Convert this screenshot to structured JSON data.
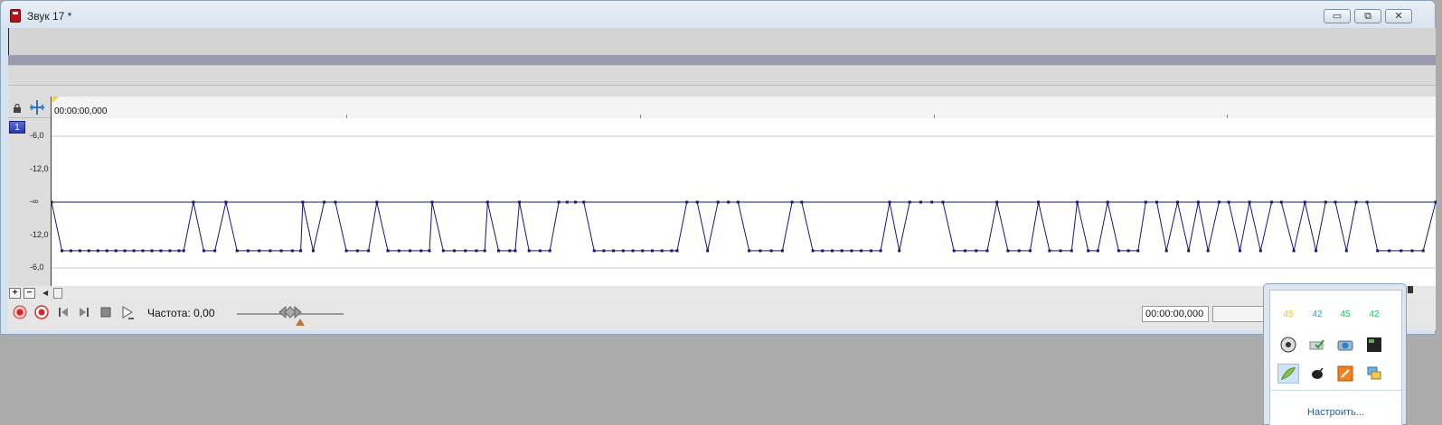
{
  "window": {
    "title": "Звук 17 *",
    "minimize_glyph": "▭",
    "maximize_glyph": "⧉",
    "close_glyph": "✕"
  },
  "timeline": {
    "time_start": "00:00:00,000"
  },
  "track": {
    "number": "1",
    "y_labels": [
      "-6,0",
      "-12,0",
      "-∞",
      "-12,0",
      "-6,0"
    ]
  },
  "controls": {
    "zoom_in": "+",
    "zoom_out": "−",
    "scroll_left": "◀",
    "frequency_label": "Частота: 0,00",
    "time_display": "00:00:00,000"
  },
  "tray": {
    "numbers": [
      {
        "value": "45",
        "color": "#e8c420"
      },
      {
        "value": "42",
        "color": "#19a8d8"
      },
      {
        "value": "45",
        "color": "#22c16b"
      },
      {
        "value": "42",
        "color": "#22c16b"
      }
    ],
    "icons": [
      "disk-icon",
      "checkmark-drive-icon",
      "camera-icon",
      "terminal-icon",
      "leaf-icon",
      "satellite-icon",
      "orange-app-icon",
      "network-icon"
    ],
    "customize": "Настроить..."
  },
  "colors": {
    "envelope": "#15157a",
    "track_band": "#9999af"
  },
  "envelope": {
    "y_levels": {
      "-inf": 0.5,
      "low": 0.79
    },
    "x_range": [
      0,
      1
    ],
    "points": [
      [
        0.0,
        "-inf"
      ],
      [
        0.0075,
        "low"
      ],
      [
        0.014,
        "low"
      ],
      [
        0.0205,
        "low"
      ],
      [
        0.027,
        "low"
      ],
      [
        0.0335,
        "low"
      ],
      [
        0.04,
        "low"
      ],
      [
        0.0465,
        "low"
      ],
      [
        0.053,
        "low"
      ],
      [
        0.0595,
        "low"
      ],
      [
        0.066,
        "low"
      ],
      [
        0.0725,
        "low"
      ],
      [
        0.079,
        "low"
      ],
      [
        0.0855,
        "low"
      ],
      [
        0.092,
        "low"
      ],
      [
        0.0955,
        "low"
      ],
      [
        0.1025,
        "-inf"
      ],
      [
        0.11,
        "low"
      ],
      [
        0.118,
        "low"
      ],
      [
        0.126,
        "-inf"
      ],
      [
        0.134,
        "low"
      ],
      [
        0.142,
        "low"
      ],
      [
        0.15,
        "low"
      ],
      [
        0.158,
        "low"
      ],
      [
        0.166,
        "low"
      ],
      [
        0.174,
        "low"
      ],
      [
        0.18,
        "low"
      ],
      [
        0.1815,
        "-inf"
      ],
      [
        0.189,
        "low"
      ],
      [
        0.197,
        "-inf"
      ],
      [
        0.205,
        "-inf"
      ],
      [
        0.213,
        "low"
      ],
      [
        0.221,
        "low"
      ],
      [
        0.229,
        "low"
      ],
      [
        0.235,
        "-inf"
      ],
      [
        0.243,
        "low"
      ],
      [
        0.251,
        "low"
      ],
      [
        0.259,
        "low"
      ],
      [
        0.267,
        "low"
      ],
      [
        0.273,
        "low"
      ],
      [
        0.275,
        "-inf"
      ],
      [
        0.283,
        "low"
      ],
      [
        0.291,
        "low"
      ],
      [
        0.299,
        "low"
      ],
      [
        0.307,
        "low"
      ],
      [
        0.313,
        "low"
      ],
      [
        0.315,
        "-inf"
      ],
      [
        0.323,
        "low"
      ],
      [
        0.331,
        "low"
      ],
      [
        0.335,
        "low"
      ],
      [
        0.338,
        "-inf"
      ],
      [
        0.345,
        "low"
      ],
      [
        0.353,
        "low"
      ],
      [
        0.36,
        "low"
      ],
      [
        0.3665,
        "-inf"
      ],
      [
        0.3725,
        "-inf"
      ],
      [
        0.3785,
        "-inf"
      ],
      [
        0.3845,
        "-inf"
      ],
      [
        0.392,
        "low"
      ],
      [
        0.399,
        "low"
      ],
      [
        0.406,
        "low"
      ],
      [
        0.413,
        "low"
      ],
      [
        0.42,
        "low"
      ],
      [
        0.427,
        "low"
      ],
      [
        0.434,
        "low"
      ],
      [
        0.441,
        "low"
      ],
      [
        0.448,
        "low"
      ],
      [
        0.452,
        "low"
      ],
      [
        0.459,
        "-inf"
      ],
      [
        0.4665,
        "-inf"
      ],
      [
        0.474,
        "low"
      ],
      [
        0.4815,
        "-inf"
      ],
      [
        0.489,
        "-inf"
      ],
      [
        0.496,
        "-inf"
      ],
      [
        0.504,
        "low"
      ],
      [
        0.512,
        "low"
      ],
      [
        0.52,
        "low"
      ],
      [
        0.528,
        "low"
      ],
      [
        0.535,
        "-inf"
      ],
      [
        0.542,
        "-inf"
      ],
      [
        0.55,
        "low"
      ],
      [
        0.557,
        "low"
      ],
      [
        0.564,
        "low"
      ],
      [
        0.571,
        "low"
      ],
      [
        0.578,
        "low"
      ],
      [
        0.585,
        "low"
      ],
      [
        0.592,
        "low"
      ],
      [
        0.599,
        "low"
      ],
      [
        0.6055,
        "-inf"
      ],
      [
        0.6125,
        "low"
      ],
      [
        0.62,
        "-inf"
      ],
      [
        0.628,
        "-inf"
      ],
      [
        0.636,
        "-inf"
      ],
      [
        0.644,
        "-inf"
      ],
      [
        0.652,
        "low"
      ],
      [
        0.66,
        "low"
      ],
      [
        0.668,
        "low"
      ],
      [
        0.676,
        "low"
      ],
      [
        0.683,
        "-inf"
      ],
      [
        0.691,
        "low"
      ],
      [
        0.699,
        "low"
      ],
      [
        0.707,
        "low"
      ],
      [
        0.713,
        "-inf"
      ],
      [
        0.721,
        "low"
      ],
      [
        0.729,
        "low"
      ],
      [
        0.737,
        "low"
      ],
      [
        0.741,
        "-inf"
      ],
      [
        0.749,
        "low"
      ],
      [
        0.756,
        "low"
      ],
      [
        0.763,
        "-inf"
      ],
      [
        0.771,
        "low"
      ],
      [
        0.778,
        "low"
      ],
      [
        0.785,
        "low"
      ],
      [
        0.7905,
        "-inf"
      ],
      [
        0.7985,
        "-inf"
      ],
      [
        0.8055,
        "low"
      ],
      [
        0.8135,
        "-inf"
      ],
      [
        0.8215,
        "low"
      ],
      [
        0.8285,
        "-inf"
      ],
      [
        0.8355,
        "low"
      ],
      [
        0.8435,
        "-inf"
      ],
      [
        0.8505,
        "-inf"
      ],
      [
        0.8585,
        "low"
      ],
      [
        0.8655,
        "-inf"
      ],
      [
        0.8735,
        "low"
      ],
      [
        0.8815,
        "-inf"
      ],
      [
        0.8885,
        "-inf"
      ],
      [
        0.8975,
        "low"
      ],
      [
        0.9055,
        "-inf"
      ],
      [
        0.9135,
        "low"
      ],
      [
        0.9205,
        "-inf"
      ],
      [
        0.9275,
        "-inf"
      ],
      [
        0.9355,
        "low"
      ],
      [
        0.9425,
        "-inf"
      ],
      [
        0.9505,
        "-inf"
      ],
      [
        0.958,
        "low"
      ],
      [
        0.9665,
        "low"
      ],
      [
        0.975,
        "low"
      ],
      [
        0.983,
        "low"
      ],
      [
        0.991,
        "low"
      ],
      [
        1.0,
        "-inf"
      ]
    ]
  }
}
